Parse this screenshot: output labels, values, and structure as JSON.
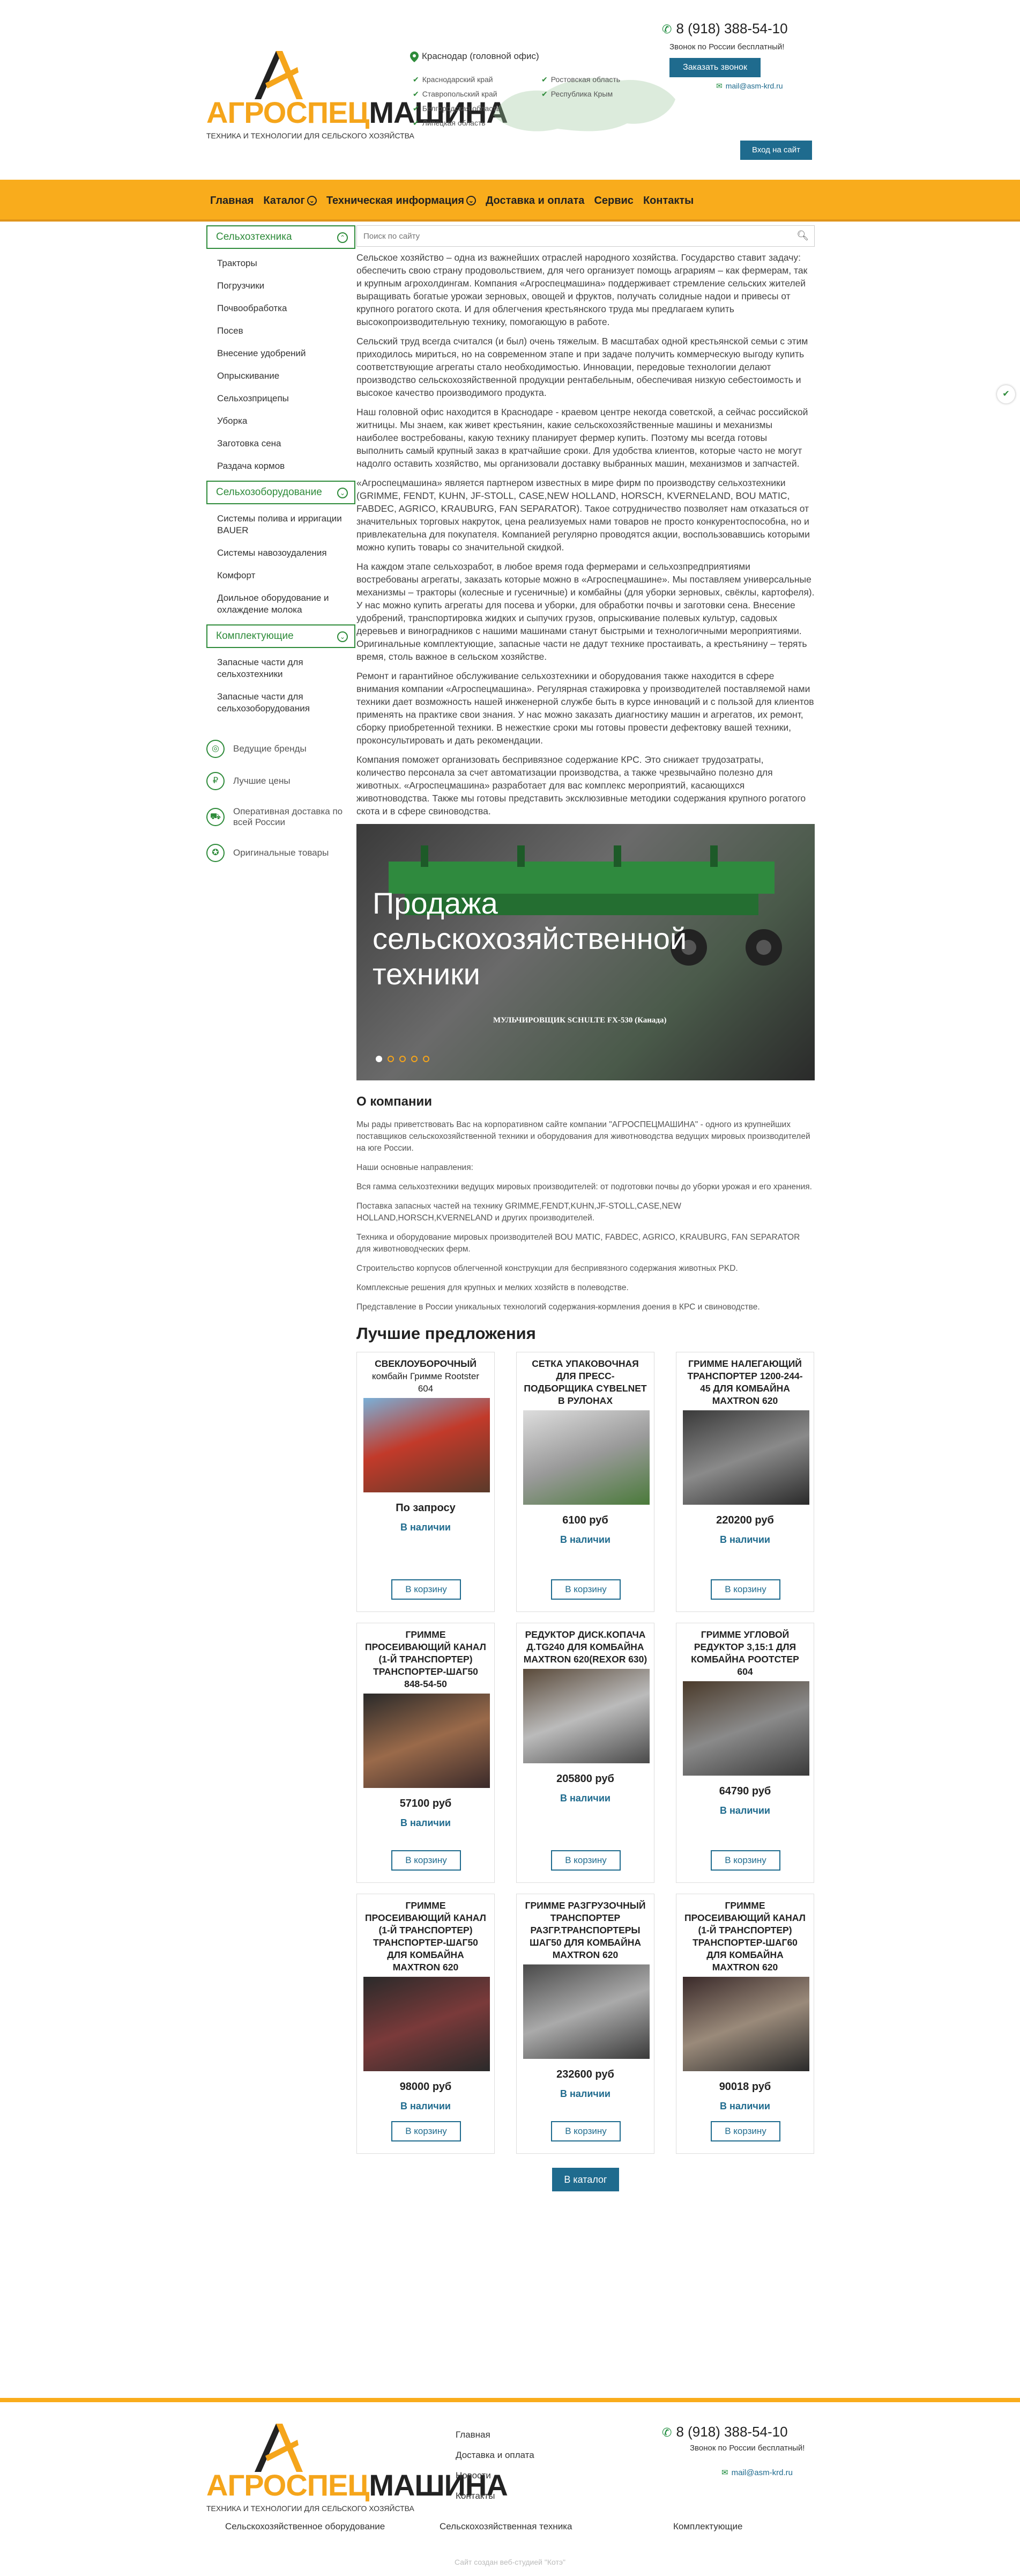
{
  "header": {
    "logo_title_a": "АГРОСПЕЦ",
    "logo_title_b": "МАШИНА",
    "logo_subtitle": "ТЕХНИКА И ТЕХНОЛОГИИ ДЛЯ СЕЛЬСКОГО ХОЗЯЙСТВА",
    "office": "Краснодар (головной офис)",
    "regions_col1": [
      "Краснодарский край",
      "Ставропольский край",
      "Белгородская область",
      "Липецкая область"
    ],
    "regions_col2": [
      "Ростовская область",
      "Республика Крым"
    ],
    "phone": "8 (918) 388-54-10",
    "free_call": "Звонок по России бесплатный!",
    "callback_label": "Заказать звонок",
    "email": "mail@asm-krd.ru",
    "login_label": "Вход на сайт"
  },
  "nav": {
    "items": [
      "Главная",
      "Каталог",
      "Техническая информация",
      "Доставка и оплата",
      "Сервис",
      "Контакты"
    ]
  },
  "sidebar": {
    "groups": [
      {
        "title": "Сельхозтехника",
        "items": [
          "Тракторы",
          "Погрузчики",
          "Почвообработка",
          "Посев",
          "Внесение удобрений",
          "Опрыскивание",
          "Сельхозприцепы",
          "Уборка",
          "Заготовка сена",
          "Раздача кормов"
        ]
      },
      {
        "title": "Сельхозоборудование",
        "items": [
          "Системы полива и ирригации BAUER",
          "Системы навозоудаления",
          "Комфорт",
          "Доильное оборудование и охлаждение молока"
        ]
      },
      {
        "title": "Комплектующие",
        "items": [
          "Запасные части для сельхозтехники",
          "Запасные части для сельхозоборудования"
        ]
      }
    ],
    "features": [
      "Ведущие бренды",
      "Лучшие цены",
      "Оперативная доставка по всей России",
      "Оригинальные товары"
    ]
  },
  "main": {
    "search_placeholder": "Поиск по сайту",
    "paragraphs": [
      "Сельское хозяйство – одна из важнейших отраслей народного хозяйства. Государство ставит задачу: обеспечить свою страну продовольствием, для чего организует помощь аграриям – как фермерам, так и крупным агрохолдингам. Компания «Агроспецмашина» поддерживает стремление сельских жителей выращивать богатые урожаи зерновых, овощей и фруктов, получать солидные надои и привесы от крупного рогатого скота. И для облегчения крестьянского труда мы предлагаем купить высокопроизводительную технику, помогающую в работе.",
      "Сельский труд всегда считался (и был) очень тяжелым. В масштабах одной крестьянской семьи с этим приходилось мириться, но на современном этапе и при задаче получить коммерческую выгоду купить соответствующие агрегаты стало необходимостью. Инновации, передовые технологии делают производство сельскохозяйственной продукции рентабельным, обеспечивая низкую себестоимость и высокое качество производимого продукта.",
      "Наш головной офис находится в Краснодаре - краевом центре некогда советской, а сейчас российской житницы. Мы знаем, как живет крестьянин, какие сельскохозяйственные машины и механизмы наиболее востребованы, какую технику планирует фермер купить. Поэтому мы всегда готовы выполнить самый крупный заказ в кратчайшие сроки. Для удобства клиентов, которые часто не могут надолго оставить хозяйство, мы организовали доставку выбранных машин, механизмов и запчастей.",
      "«Агроспецмашина» является партнером известных в мире фирм по производству сельхозтехники (GRIMME, FENDT, KUHN, JF-STOLL, CASE,NEW HOLLAND, HORSCH, KVERNELAND, BOU MATIC, FABDEC, AGRICO, KRAUBURG, FAN SEPARATOR). Такое сотрудничество позволяет нам отказаться от значительных торговых накруток, цена реализуемых нами товаров не просто конкурентоспособна, но и привлекательна для покупателя. Компанией регулярно проводятся акции, воспользовавшись которыми можно купить товары со значительной скидкой.",
      "На каждом этапе сельхозработ, в любое время года фермерами и сельхозпредприятиями востребованы агрегаты, заказать которые можно в «Агроспецмашине». Мы поставляем универсальные механизмы – тракторы (колесные и гусеничные) и комбайны (для уборки зерновых, свёклы, картофеля). У нас можно купить агрегаты для посева и уборки, для обработки почвы и заготовки сена. Внесение удобрений, транспортировка жидких и сыпучих грузов, опрыскивание полевых культур, садовых деревьев и виноградников с нашими машинами станут быстрыми и технологичными мероприятиями. Оригинальные комплектующие, запасные части не дадут технике простаивать, а крестьянину – терять время, столь важное в сельском хозяйстве.",
      "Ремонт и гарантийное обслуживание сельхозтехники и оборудования также находится в сфере внимания компании «Агроспецмашина». Регулярная стажировка у производителей поставляемой нами техники дает возможность нашей инженерной службе быть в курсе инноваций и с пользой для клиентов применять на практике свои знания. У нас можно заказать диагностику машин и агрегатов, их ремонт, сборку приобретенной техники. В нежесткие сроки мы готовы провести дефектовку вашей техники, проконсультировать и дать рекомендации.",
      "Компания поможет организовать беспривязное содержание КРС. Это снижает трудозатраты, количество персонала за счет автоматизации производства, а также чрезвычайно полезно для животных. «Агроспецмашина» разработает для вас комплекс мероприятий, касающихся животноводства. Также мы готовы представить эксклюзивные методики содержания крупного рогатого скота и в сфере свиноводства."
    ],
    "slider": {
      "title": "Продажа сельскохозяйственной техники",
      "caption": "МУЛЬЧИРОВЩИК SCHULTE FX-530 (Канада)"
    },
    "about_title": "О компании",
    "about_paragraphs": [
      "Мы рады приветствовать Вас на корпоративном сайте компании \"АГРОСПЕЦМАШИНА\" - одного из крупнейших поставщиков сельскохозяйственной техники и оборудования для животноводства ведущих мировых производителей на юге России.",
      "Наши основные направления:",
      "Вся гамма сельхозтехники ведущих мировых производителей: от подготовки почвы до уборки урожая и его хранения.",
      "Поставка запасных частей на технику GRIMME,FENDT,KUHN,JF-STOLL,CASE,NEW HOLLAND,HORSCH,KVERNELAND и других производителей.",
      "Техника и оборудование мировых производителей BOU MATIC, FABDEC, AGRICO, KRAUBURG, FAN SEPARATOR для животноводческих ферм.",
      "Строительство корпусов облегченной конструкции для беспривязного содержания животных PKD.",
      "Комплексные решения для крупных и мелких хозяйств в полеводстве.",
      "Представление в России уникальных технологий содержания-кормления доения в КРС и свиноводстве."
    ],
    "offers_title": "Лучшие предложения",
    "products": [
      {
        "title": "СВЕКЛОУБОРОЧНЫЙ",
        "subtitle": "комбайн Гримме Rootster 604",
        "price": "По запросу",
        "stock": "В наличии",
        "button": "В корзину"
      },
      {
        "title": "СЕТКА УПАКОВОЧНАЯ ДЛЯ ПРЕСС-ПОДБОРЩИКА CYBELNET В РУЛОНАХ",
        "subtitle": "",
        "price": "6100 руб",
        "stock": "В наличии",
        "button": "В корзину"
      },
      {
        "title": "ГРИММЕ НАЛЕГАЮЩИЙ ТРАНСПОРТЕР 1200-244-45 ДЛЯ КОМБАЙНА MAXTRON 620",
        "subtitle": "",
        "price": "220200 руб",
        "stock": "В наличии",
        "button": "В корзину"
      },
      {
        "title": "ГРИММЕ ПРОСЕИВАЮЩИЙ КАНАЛ (1-Й ТРАНСПОРТЕР) ТРАНСПОРТЕР-ШАГ50 848-54-50",
        "subtitle": "",
        "price": "57100 руб",
        "stock": "В наличии",
        "button": "В корзину"
      },
      {
        "title": "РЕДУКТОР ДИСК.КОПАЧА Д.TG240 ДЛЯ КОМБАЙНА MAXTRON 620(REXOR 630)",
        "subtitle": "",
        "price": "205800 руб",
        "stock": "В наличии",
        "button": "В корзину"
      },
      {
        "title": "ГРИММЕ УГЛОВОЙ РЕДУКТОР 3,15:1 ДЛЯ КОМБАЙНА РООТСТЕР 604",
        "subtitle": "",
        "price": "64790 руб",
        "stock": "В наличии",
        "button": "В корзину"
      },
      {
        "title": "ГРИММЕ ПРОСЕИВАЮЩИЙ КАНАЛ (1-Й ТРАНСПОРТЕР) ТРАНСПОРТЕР-ШАГ50 ДЛЯ КОМБАЙНА MAXTRON 620",
        "subtitle": "",
        "price": "98000 руб",
        "stock": "В наличии",
        "button": "В корзину"
      },
      {
        "title": "ГРИММЕ РАЗГРУЗОЧНЫЙ ТРАНСПОРТЕР РАЗГР.ТРАНСПОРТЕРЫ ШАГ50 ДЛЯ КОМБАЙНА MAXTRON 620",
        "subtitle": "",
        "price": "232600 руб",
        "stock": "В наличии",
        "button": "В корзину"
      },
      {
        "title": "ГРИММЕ ПРОСЕИВАЮЩИЙ КАНАЛ (1-Й ТРАНСПОРТЕР) ТРАНСПОРТЕР-ШАГ60 ДЛЯ КОМБАЙНА MAXTRON 620",
        "subtitle": "",
        "price": "90018 руб",
        "stock": "В наличии",
        "button": "В корзину"
      }
    ],
    "catalog_label": "В каталог"
  },
  "footer": {
    "links": [
      "Главная",
      "Доставка и оплата",
      "Новости",
      "Контакты"
    ],
    "phone": "8 (918) 388-54-10",
    "free_call": "Звонок по России бесплатный!",
    "email": "mail@asm-krd.ru",
    "categories": [
      "Сельскохозяйственное оборудование",
      "Сельскохозяйственная техника",
      "Комплектующие"
    ],
    "copyright": "Сайт создан веб-студией \"Котэ\""
  },
  "colors": {
    "accent": "#f9ac1c",
    "brand_green": "#2e8b3a",
    "brand_blue": "#1f6b8e"
  }
}
